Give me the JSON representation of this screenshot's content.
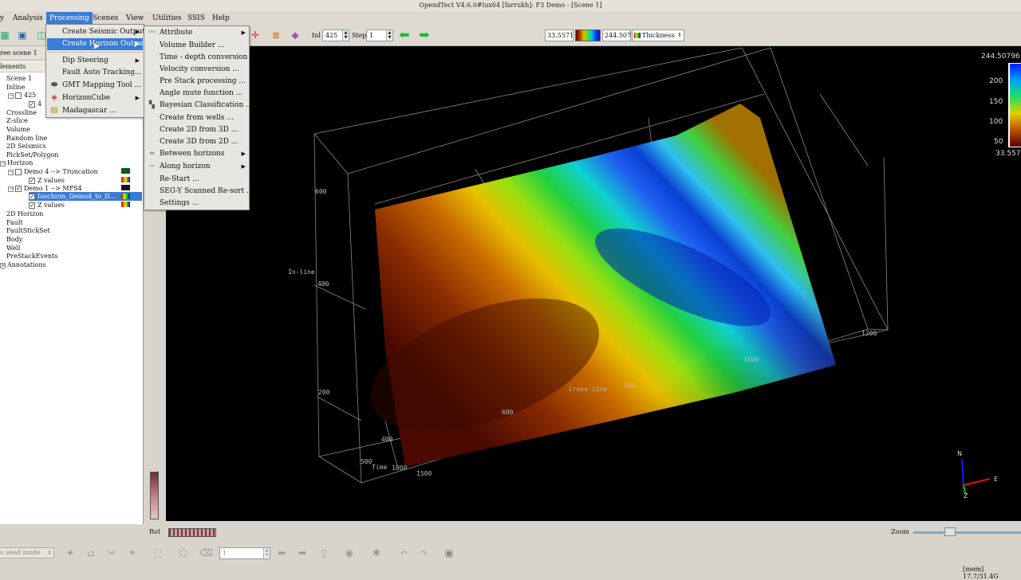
{
  "window": {
    "title": "OpendTect V4.6.0#lux64 [farrukh]: F3 Demo - [Scene 1]"
  },
  "menubar": {
    "items": [
      "Survey",
      "Analysis",
      "Processing",
      "Scenes",
      "View",
      "Utilities",
      "SSIS",
      "Help"
    ],
    "visible_first": "y",
    "active": "Processing"
  },
  "toolbar": {
    "inl_label": "Inl",
    "inl_value": "425",
    "step_label": "Step",
    "step_value": "1",
    "range_min": "33.5571",
    "range_max": "244.507",
    "attribute_select": "Thickness"
  },
  "processing_menu": {
    "items": [
      {
        "label": "Create Seismic Output",
        "submenu": true
      },
      {
        "label": "Create Horizon Output",
        "submenu": true,
        "highlighted": true
      },
      {
        "label": "Dip Steering",
        "submenu": true
      },
      {
        "label": "Fault Auto Tracking...",
        "submenu": false
      },
      {
        "label": "GMT Mapping Tool ...",
        "submenu": false
      },
      {
        "label": "HorizonCube",
        "submenu": true
      },
      {
        "label": "Madagascar ...",
        "submenu": false
      }
    ]
  },
  "horizon_submenu": {
    "items": [
      {
        "label": "Attribute",
        "submenu": true
      },
      {
        "label": "Volume Builder ...",
        "submenu": false
      },
      {
        "label": "Time - depth conversion ...",
        "submenu": false
      },
      {
        "label": "Velocity conversion ...",
        "submenu": false
      },
      {
        "label": "Pre Stack processing ...",
        "submenu": false
      },
      {
        "label": "Angle mute function ...",
        "submenu": false
      },
      {
        "label": "Bayesian Classification ...",
        "submenu": false
      },
      {
        "label": "Create from wells ...",
        "submenu": false
      },
      {
        "label": "Create 2D from 3D ...",
        "submenu": false
      },
      {
        "label": "Create 3D from 2D ...",
        "submenu": false
      },
      {
        "label": "Between horizons",
        "submenu": true
      },
      {
        "label": "Along horizon",
        "submenu": true
      },
      {
        "label": "Re-Start ...",
        "submenu": false
      },
      {
        "label": "SEG-Y Scanned Re-sort ...",
        "submenu": false
      },
      {
        "label": "Settings ...",
        "submenu": false
      }
    ]
  },
  "tree": {
    "tab": "ree scene 1",
    "header": "lements",
    "items": [
      {
        "label": "Scene 1"
      },
      {
        "label": "Inline"
      },
      {
        "label": "425"
      },
      {
        "label": "4"
      },
      {
        "label": "Crossline"
      },
      {
        "label": "Z-slice"
      },
      {
        "label": "Volume"
      },
      {
        "label": "Random line"
      },
      {
        "label": "2D Seismics"
      },
      {
        "label": "PickSet/Polygon"
      },
      {
        "label": "Horizon"
      },
      {
        "label": "Demo 4 --> Truncation"
      },
      {
        "label": "Z values"
      },
      {
        "label": "Demo 1 --> MFS4"
      },
      {
        "label": "Isochron_Demo4_to_D..."
      },
      {
        "label": "Z values"
      },
      {
        "label": "2D Horizon"
      },
      {
        "label": "Fault"
      },
      {
        "label": "FaultStickSet"
      },
      {
        "label": "Body"
      },
      {
        "label": "Well"
      },
      {
        "label": "PreStackEvents"
      },
      {
        "label": "Annotations"
      }
    ]
  },
  "scene": {
    "axis_inline": "In-line",
    "axis_crossline": "Cross-line",
    "axis_time": "Time",
    "inline_ticks": [
      "600",
      "400",
      "200"
    ],
    "crossline_ticks": [
      "1200",
      "1000",
      "800",
      "600",
      "400"
    ],
    "time_ticks": [
      "500",
      "1000",
      "1500"
    ],
    "compass_n": "N",
    "compass_e": "E",
    "compass_z": "Z"
  },
  "colorbar": {
    "max": "244.50796",
    "min": "33.557175",
    "ticks": [
      "200",
      "150",
      "100",
      "50"
    ]
  },
  "bottom": {
    "rot_label": "Rot",
    "zoom_label": "Zoom",
    "seed_mode": "o seed mode",
    "page_value": "1",
    "mem": "[mem] 17.7/31.4G"
  }
}
